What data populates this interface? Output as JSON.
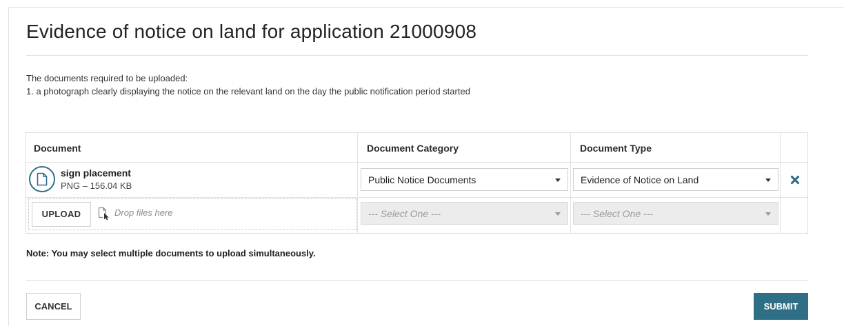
{
  "page": {
    "title": "Evidence of notice on land for application 21000908",
    "intro_line1": "The documents required to be uploaded:",
    "intro_line2": "1. a photograph clearly displaying the notice on the relevant land on the day the public notification period started"
  },
  "table": {
    "columns": [
      "Document",
      "Document Category",
      "Document Type"
    ],
    "rows": [
      {
        "file_name": "sign placement",
        "file_meta": "PNG – 156.04 KB",
        "category": "Public Notice Documents",
        "type": "Evidence of Notice on Land",
        "icon": "file-icon",
        "remove_icon": "close-icon"
      }
    ],
    "upload": {
      "button_label": "UPLOAD",
      "drop_text": "Drop files here",
      "drop_icon": "file-pointer-icon",
      "category_placeholder": "--- Select One ---",
      "type_placeholder": "--- Select One ---"
    }
  },
  "note": "Note: You may select multiple documents to upload simultaneously.",
  "actions": {
    "cancel": "CANCEL",
    "submit": "SUBMIT"
  },
  "colors": {
    "accent": "#2f6f85",
    "border": "#dcdcdc",
    "disabled_bg": "#ececec"
  }
}
